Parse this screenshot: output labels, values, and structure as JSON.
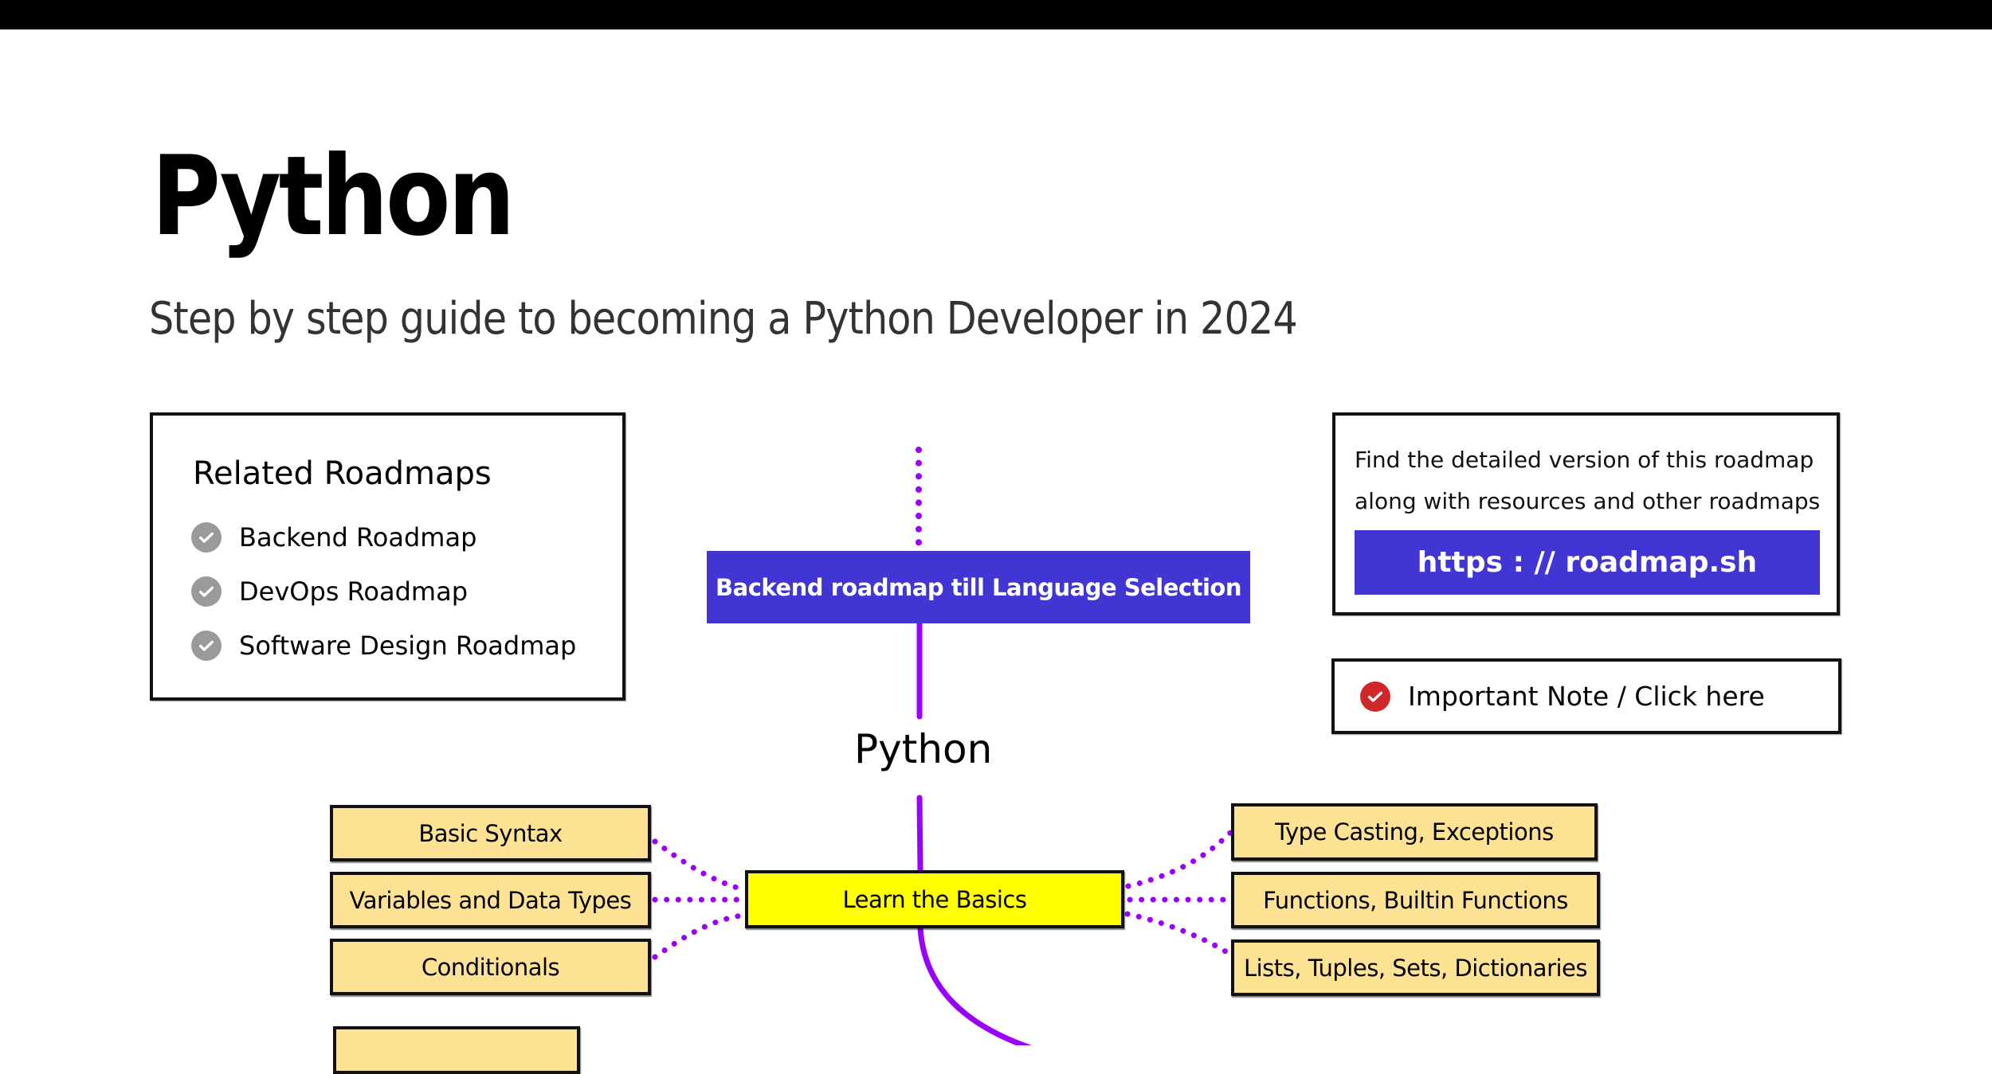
{
  "header": {
    "title": "Python",
    "subtitle": "Step by step guide to becoming a Python Developer in 2024"
  },
  "related_roadmaps": {
    "heading": "Related Roadmaps",
    "items": [
      {
        "label": "Backend Roadmap",
        "icon": "check-circle-icon"
      },
      {
        "label": "DevOps Roadmap",
        "icon": "check-circle-icon"
      },
      {
        "label": "Software Design Roadmap",
        "icon": "check-circle-icon"
      }
    ]
  },
  "info_card": {
    "line1": "Find the detailed version of this roadmap",
    "line2": "along with resources and other roadmaps",
    "link_label": "https : // roadmap.sh"
  },
  "important_note": {
    "label": "Important Note / Click here",
    "icon": "check-circle-icon"
  },
  "roadmap": {
    "backend_node": "Backend roadmap till Language Selection",
    "section_label": "Python",
    "main_node": "Learn the Basics",
    "left_topics": [
      "Basic Syntax",
      "Variables and Data Types",
      "Conditionals"
    ],
    "right_topics": [
      "Type Casting, Exceptions",
      "Functions, Builtin Functions",
      "Lists, Tuples, Sets, Dictionaries"
    ],
    "partial_node": ""
  },
  "colors": {
    "accent_blue": "#4136d4",
    "connector_purple": "#9900ff",
    "main_node_yellow": "#ffff00",
    "topic_node_tan": "#fde293",
    "check_gray": "#9a9a9a",
    "check_red": "#d0282a"
  }
}
